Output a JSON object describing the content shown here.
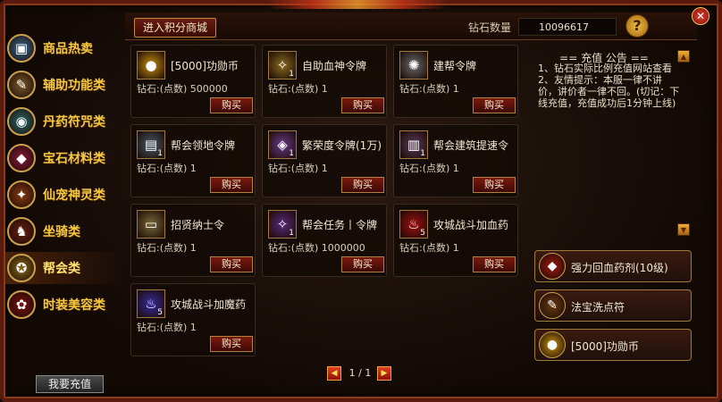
{
  "header": {
    "shop_button": "进入积分商城",
    "diamond_label": "钻石数量",
    "diamond_value": "10096617",
    "help_glyph": "?",
    "close_glyph": "✕"
  },
  "sidebar": {
    "items": [
      {
        "label": "商品热卖",
        "icon": "treasure-chest-icon",
        "glyph": "▣",
        "color": "#3a6a8a",
        "active": false
      },
      {
        "label": "辅助功能类",
        "icon": "scroll-icon",
        "glyph": "✎",
        "color": "#7a5a2a",
        "active": false
      },
      {
        "label": "丹药符咒类",
        "icon": "elixir-orb-icon",
        "glyph": "◉",
        "color": "#2a6a6a",
        "active": false
      },
      {
        "label": "宝石材料类",
        "icon": "gem-icon",
        "glyph": "◆",
        "color": "#8a1a3a",
        "active": false
      },
      {
        "label": "仙宠神灵类",
        "icon": "phoenix-icon",
        "glyph": "✦",
        "color": "#8a3a10",
        "active": false
      },
      {
        "label": "坐骑类",
        "icon": "mount-icon",
        "glyph": "♞",
        "color": "#6a2010",
        "active": false
      },
      {
        "label": "帮会类",
        "icon": "guild-icon",
        "glyph": "✪",
        "color": "#8a6a1a",
        "active": true
      },
      {
        "label": "时装美容类",
        "icon": "fashion-icon",
        "glyph": "✿",
        "color": "#7a1010",
        "active": false
      }
    ],
    "recharge_button": "我要充值"
  },
  "items": [
    {
      "name": "[5000]功勋币",
      "price_label": "钻石:(点数)",
      "price": "500000",
      "count": "",
      "icon": "gold-coin-icon",
      "glyph": "●",
      "color": "#c89010",
      "buy": "购买"
    },
    {
      "name": "自助血神令牌",
      "price_label": "钻石:(点数)",
      "price": "1",
      "count": "1",
      "icon": "blood-token-icon",
      "glyph": "✧",
      "color": "#8a6a20",
      "buy": "购买"
    },
    {
      "name": "建帮令牌",
      "price_label": "钻石:(点数)",
      "price": "1",
      "count": "",
      "icon": "guild-token-icon",
      "glyph": "✺",
      "color": "#6a6a6a",
      "buy": "购买"
    },
    {
      "name": "帮会领地令牌",
      "price_label": "钻石:(点数)",
      "price": "1",
      "count": "1",
      "icon": "territory-token-icon",
      "glyph": "▤",
      "color": "#4a5a6a",
      "buy": "购买"
    },
    {
      "name": "繁荣度令牌(1万)",
      "price_label": "钻石:(点数)",
      "price": "1",
      "count": "1",
      "icon": "prosperity-token-icon",
      "glyph": "◈",
      "color": "#6a3a8a",
      "buy": "购买"
    },
    {
      "name": "帮会建筑提速令",
      "price_label": "钻石:(点数)",
      "price": "1",
      "count": "1",
      "icon": "building-token-icon",
      "glyph": "▥",
      "color": "#5a3a5a",
      "buy": "购买"
    },
    {
      "name": "招贤纳士令",
      "price_label": "钻石:(点数)",
      "price": "1",
      "count": "",
      "icon": "recruit-scroll-icon",
      "glyph": "▭",
      "color": "#7a6a3a",
      "buy": "购买"
    },
    {
      "name": "帮会任务丨令牌",
      "price_label": "钻石:(点数)",
      "price": "1000000",
      "count": "1",
      "icon": "quest-token-icon",
      "glyph": "✧",
      "color": "#5a2a7a",
      "buy": "购买"
    },
    {
      "name": "攻城战斗加血药",
      "price_label": "钻石:(点数)",
      "price": "1",
      "count": "5",
      "icon": "red-potion-icon",
      "glyph": "♨",
      "color": "#a01010",
      "buy": "购买"
    },
    {
      "name": "攻城战斗加魔药",
      "price_label": "钻石:(点数)",
      "price": "1",
      "count": "5",
      "icon": "blue-potion-icon",
      "glyph": "♨",
      "color": "#3a2aa0",
      "buy": "购买"
    }
  ],
  "pager": {
    "prev_glyph": "◀",
    "next_glyph": "▶",
    "text": "1 / 1"
  },
  "notice": {
    "title": "== 充值 公告 ==",
    "lines": [
      "1、钻石实际比例充值网站查看",
      "2、友情提示：本服一律不讲价，讲价者一律不回。(切记：下线充值，充值成功后1分钟上线)"
    ],
    "scroll_up": "▲",
    "scroll_down": "▼"
  },
  "quick_items": [
    {
      "label": "强力回血药剂(10级)",
      "icon": "healing-potion-icon",
      "glyph": "◆",
      "color": "#a01a10"
    },
    {
      "label": "法宝洗点符",
      "icon": "talisman-icon",
      "glyph": "✎",
      "color": "#6a3a10"
    },
    {
      "label": "[5000]功勋币",
      "icon": "gold-coin-icon",
      "glyph": "●",
      "color": "#c89010"
    }
  ]
}
